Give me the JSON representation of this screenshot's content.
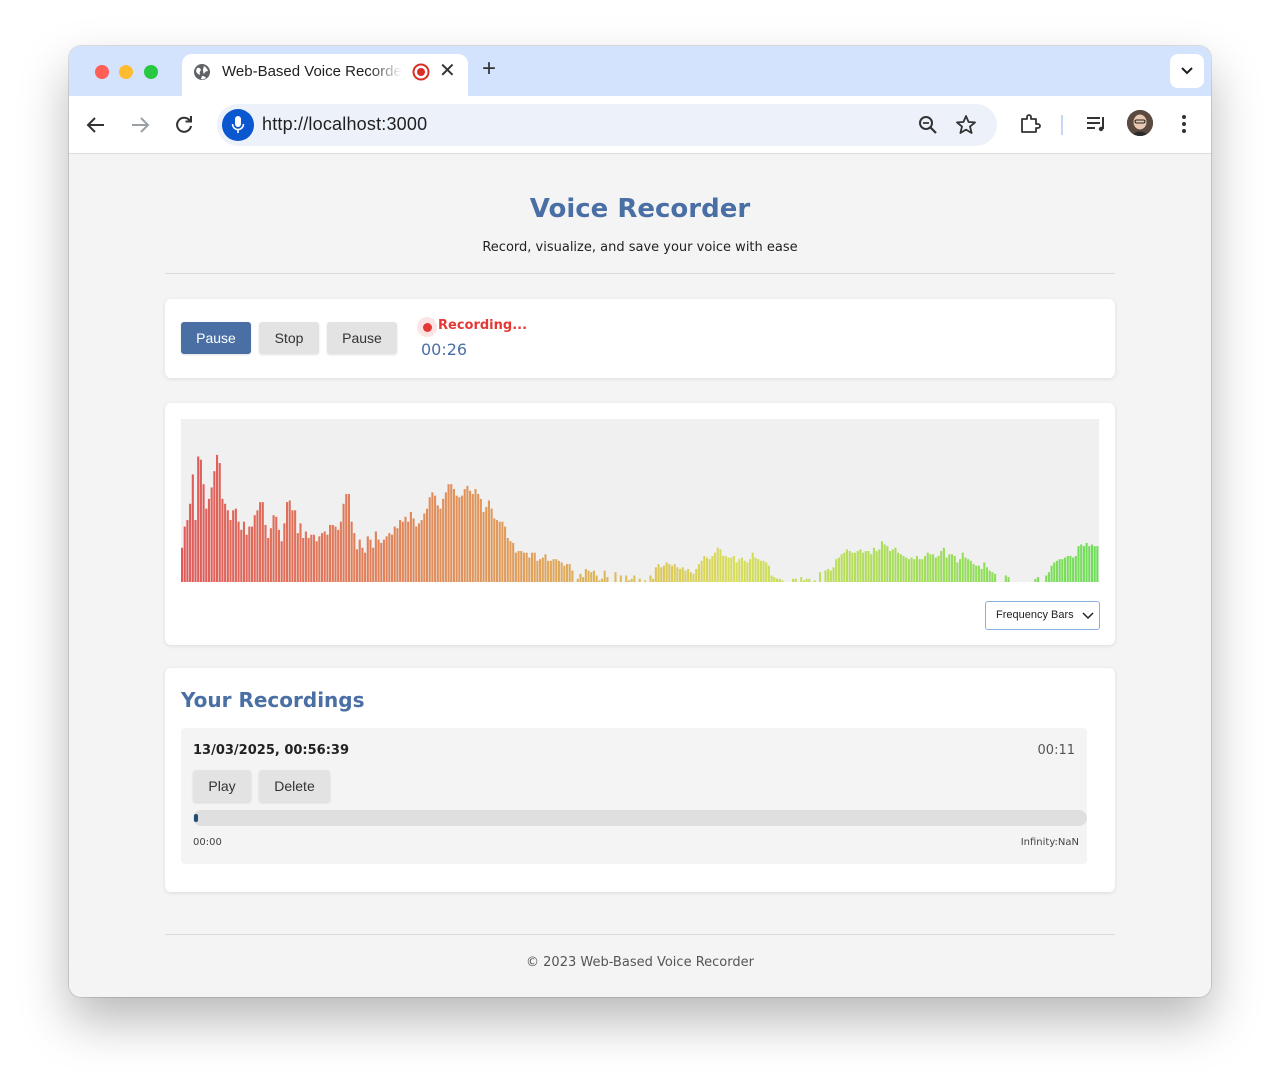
{
  "browser": {
    "tab_title": "Web-Based Voice Recorder",
    "url": "http://localhost:3000",
    "icons": {
      "favicon": "globe-icon",
      "tab_indicator": "recording-indicator-icon",
      "tab_close": "close-icon",
      "new_tab": "plus-icon",
      "tab_menu": "chevron-down-icon",
      "back": "arrow-left-icon",
      "forward": "arrow-right-icon",
      "reload": "reload-icon",
      "mic": "microphone-icon",
      "zoom": "zoom-icon",
      "bookmark": "star-icon",
      "extensions": "puzzle-icon",
      "media": "media-queue-icon",
      "profile": "avatar",
      "menu": "kebab-menu-icon"
    }
  },
  "page": {
    "title": "Voice Recorder",
    "subtitle": "Record, visualize, and save your voice with ease",
    "accent_color": "#4a6fa5",
    "recording_color": "#e53935"
  },
  "controls": {
    "primary_label": "Pause",
    "stop_label": "Stop",
    "pause_label": "Pause",
    "status": "Recording...",
    "timer": "00:26"
  },
  "visualizer": {
    "mode": "Frequency Bars",
    "gradient_colors": [
      "#e05a5a",
      "#e0a05a",
      "#d8dd5a",
      "#6fdd5a"
    ],
    "levels": [
      0.21,
      0.34,
      0.38,
      0.48,
      0.66,
      0.38,
      0.77,
      0.75,
      0.6,
      0.45,
      0.51,
      0.58,
      0.68,
      0.78,
      0.73,
      0.51,
      0.48,
      0.44,
      0.38,
      0.44,
      0.45,
      0.37,
      0.32,
      0.37,
      0.29,
      0.34,
      0.34,
      0.41,
      0.44,
      0.49,
      0.49,
      0.35,
      0.27,
      0.33,
      0.41,
      0.4,
      0.32,
      0.25,
      0.36,
      0.49,
      0.5,
      0.44,
      0.44,
      0.3,
      0.36,
      0.27,
      0.31,
      0.27,
      0.29,
      0.29,
      0.25,
      0.28,
      0.3,
      0.31,
      0.29,
      0.35,
      0.35,
      0.34,
      0.32,
      0.37,
      0.48,
      0.54,
      0.54,
      0.37,
      0.3,
      0.2,
      0.26,
      0.21,
      0.18,
      0.28,
      0.26,
      0.21,
      0.31,
      0.26,
      0.24,
      0.26,
      0.28,
      0.3,
      0.29,
      0.34,
      0.33,
      0.38,
      0.37,
      0.4,
      0.37,
      0.43,
      0.39,
      0.34,
      0.36,
      0.38,
      0.42,
      0.45,
      0.52,
      0.55,
      0.53,
      0.47,
      0.45,
      0.51,
      0.55,
      0.6,
      0.6,
      0.57,
      0.53,
      0.52,
      0.53,
      0.57,
      0.59,
      0.56,
      0.54,
      0.57,
      0.54,
      0.51,
      0.43,
      0.46,
      0.5,
      0.45,
      0.39,
      0.38,
      0.37,
      0.37,
      0.34,
      0.27,
      0.25,
      0.24,
      0.18,
      0.19,
      0.19,
      0.18,
      0.18,
      0.15,
      0.18,
      0.18,
      0.13,
      0.14,
      0.15,
      0.17,
      0.13,
      0.13,
      0.14,
      0.14,
      0.13,
      0.12,
      0.1,
      0.11,
      0.11,
      0.07,
      0.0,
      0.02,
      0.05,
      0.03,
      0.08,
      0.07,
      0.06,
      0.07,
      0.04,
      0.01,
      0.02,
      0.07,
      0.03,
      0.0,
      0.0,
      0.06,
      0.0,
      0.04,
      0.0,
      0.04,
      0.01,
      0.02,
      0.04,
      0.0,
      0.02,
      0.0,
      0.01,
      0.0,
      0.04,
      0.02,
      0.09,
      0.11,
      0.09,
      0.1,
      0.12,
      0.11,
      0.1,
      0.11,
      0.09,
      0.08,
      0.09,
      0.07,
      0.08,
      0.06,
      0.05,
      0.08,
      0.11,
      0.13,
      0.16,
      0.15,
      0.14,
      0.16,
      0.18,
      0.21,
      0.2,
      0.16,
      0.16,
      0.15,
      0.15,
      0.16,
      0.12,
      0.14,
      0.15,
      0.13,
      0.12,
      0.14,
      0.18,
      0.15,
      0.14,
      0.13,
      0.13,
      0.12,
      0.1,
      0.04,
      0.03,
      0.02,
      0.02,
      0.01,
      0.0,
      0.0,
      0.0,
      0.02,
      0.02,
      0.0,
      0.03,
      0.01,
      0.02,
      0.02,
      0.0,
      0.01,
      0.0,
      0.06,
      0.0,
      0.07,
      0.08,
      0.07,
      0.09,
      0.14,
      0.15,
      0.17,
      0.18,
      0.2,
      0.19,
      0.18,
      0.18,
      0.19,
      0.2,
      0.18,
      0.19,
      0.19,
      0.17,
      0.21,
      0.19,
      0.2,
      0.25,
      0.23,
      0.22,
      0.19,
      0.2,
      0.21,
      0.18,
      0.17,
      0.16,
      0.15,
      0.14,
      0.15,
      0.14,
      0.16,
      0.14,
      0.14,
      0.16,
      0.18,
      0.17,
      0.17,
      0.15,
      0.16,
      0.19,
      0.21,
      0.15,
      0.17,
      0.17,
      0.16,
      0.12,
      0.14,
      0.18,
      0.15,
      0.14,
      0.13,
      0.11,
      0.1,
      0.1,
      0.08,
      0.12,
      0.09,
      0.07,
      0.06,
      0.05,
      0.0,
      0.0,
      0.0,
      0.04,
      0.03,
      0.0,
      0.0,
      0.0,
      0.0,
      0.0,
      0.0,
      0.0,
      0.0,
      0.0,
      0.02,
      0.03,
      0.0,
      0.0,
      0.04,
      0.06,
      0.1,
      0.12,
      0.13,
      0.14,
      0.14,
      0.15,
      0.16,
      0.16,
      0.15,
      0.16,
      0.22,
      0.23,
      0.22,
      0.24,
      0.22,
      0.23,
      0.22,
      0.22
    ]
  },
  "recordings": {
    "heading": "Your Recordings",
    "items": [
      {
        "date": "13/03/2025, 00:56:39",
        "duration": "00:11",
        "play_label": "Play",
        "delete_label": "Delete",
        "progress": 0.0,
        "current_time": "00:00",
        "total_time": "Infinity:NaN"
      }
    ]
  },
  "footer": {
    "text": "© 2023 Web-Based Voice Recorder"
  }
}
